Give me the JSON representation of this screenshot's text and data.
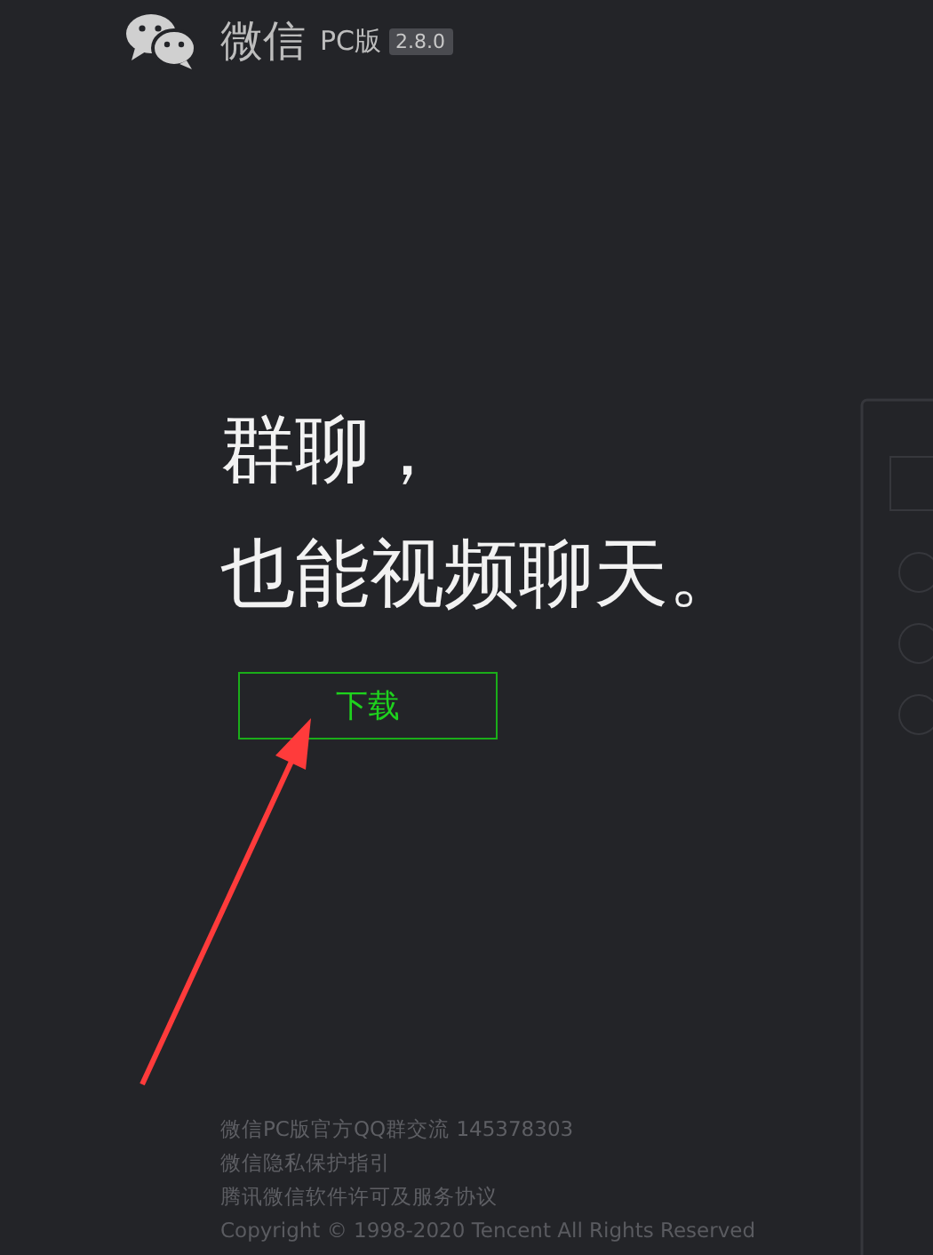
{
  "header": {
    "app_name": "微信",
    "edition": "PC版",
    "version": "2.8.0"
  },
  "headline": [
    "群聊，",
    "也能视频聊天。"
  ],
  "download_button": "下载",
  "footer": [
    "微信PC版官方QQ群交流 145378303",
    "微信隐私保护指引",
    "腾讯微信软件许可及服务协议",
    "Copyright © 1998-2020 Tencent All Rights Reserved"
  ]
}
